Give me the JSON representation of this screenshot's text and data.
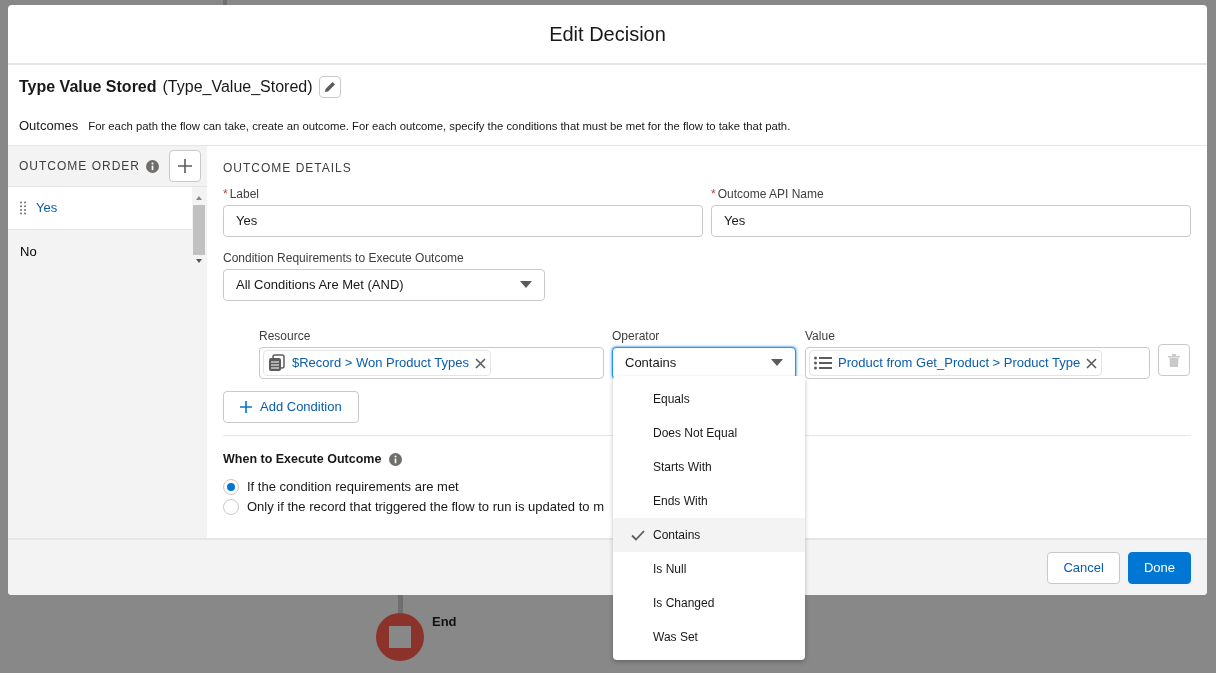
{
  "modal": {
    "title": "Edit Decision"
  },
  "element": {
    "label": "Type Value Stored",
    "api_name": "(Type_Value_Stored)"
  },
  "intro": {
    "label": "Outcomes",
    "description": "For each path the flow can take, create an outcome. For each outcome, specify the conditions that must be met for the flow to take that path."
  },
  "outcome_order": {
    "title": "OUTCOME ORDER",
    "items": [
      {
        "label": "Yes",
        "selected": true
      },
      {
        "label": "No",
        "selected": false
      }
    ]
  },
  "details": {
    "title": "OUTCOME DETAILS",
    "fields": [
      {
        "required_mark": "*",
        "label": "Label",
        "value": "Yes"
      },
      {
        "required_mark": "*",
        "label": "Outcome API Name",
        "value": "Yes"
      }
    ],
    "condition_requirements": {
      "label": "Condition Requirements to Execute Outcome",
      "value": "All Conditions Are Met (AND)"
    },
    "condition": {
      "resource_label": "Resource",
      "resource": "$Record > Won Product Types",
      "operator_label": "Operator",
      "operator": "Contains",
      "value_label": "Value",
      "value": "Product from Get_Product > Product Type"
    },
    "add_condition": "Add Condition",
    "when": {
      "title": "When to Execute Outcome",
      "options": [
        {
          "label": "If the condition requirements are met",
          "selected": true
        },
        {
          "label": "Only if the record that triggered the flow to run is updated to m",
          "selected": false
        }
      ]
    }
  },
  "operator_menu": {
    "items": [
      {
        "label": "Equals",
        "selected": false
      },
      {
        "label": "Does Not Equal",
        "selected": false
      },
      {
        "label": "Starts With",
        "selected": false
      },
      {
        "label": "Ends With",
        "selected": false
      },
      {
        "label": "Contains",
        "selected": true
      },
      {
        "label": "Is Null",
        "selected": false
      },
      {
        "label": "Is Changed",
        "selected": false
      },
      {
        "label": "Was Set",
        "selected": false
      }
    ]
  },
  "footer": {
    "buttons": [
      {
        "label": "Cancel",
        "kind": "neutral"
      },
      {
        "label": "Done",
        "kind": "brand"
      }
    ]
  },
  "canvas": {
    "end_node": "End"
  }
}
